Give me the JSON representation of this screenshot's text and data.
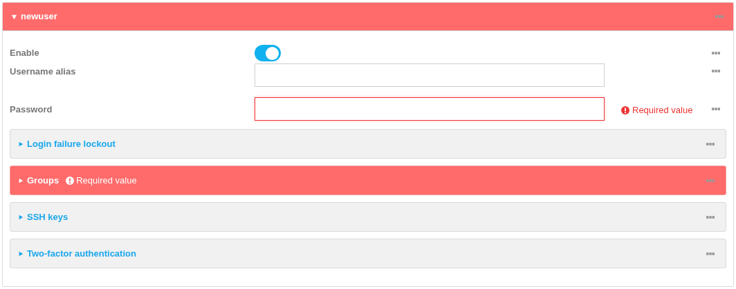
{
  "panel": {
    "title": "newuser",
    "expanded": true,
    "invalid": true
  },
  "fields": [
    {
      "kind": "toggle",
      "label": "Enable",
      "on": true
    },
    {
      "kind": "text",
      "label": "Username alias"
    },
    {
      "kind": "password",
      "label": "Password",
      "error": "Required value"
    }
  ],
  "sections": [
    {
      "title": "Login failure lockout",
      "expanded": false
    },
    {
      "title": "Groups",
      "expanded": false,
      "error": "Required value"
    },
    {
      "title": "SSH keys",
      "expanded": false
    },
    {
      "title": "Two-factor authentication",
      "expanded": false
    }
  ]
}
